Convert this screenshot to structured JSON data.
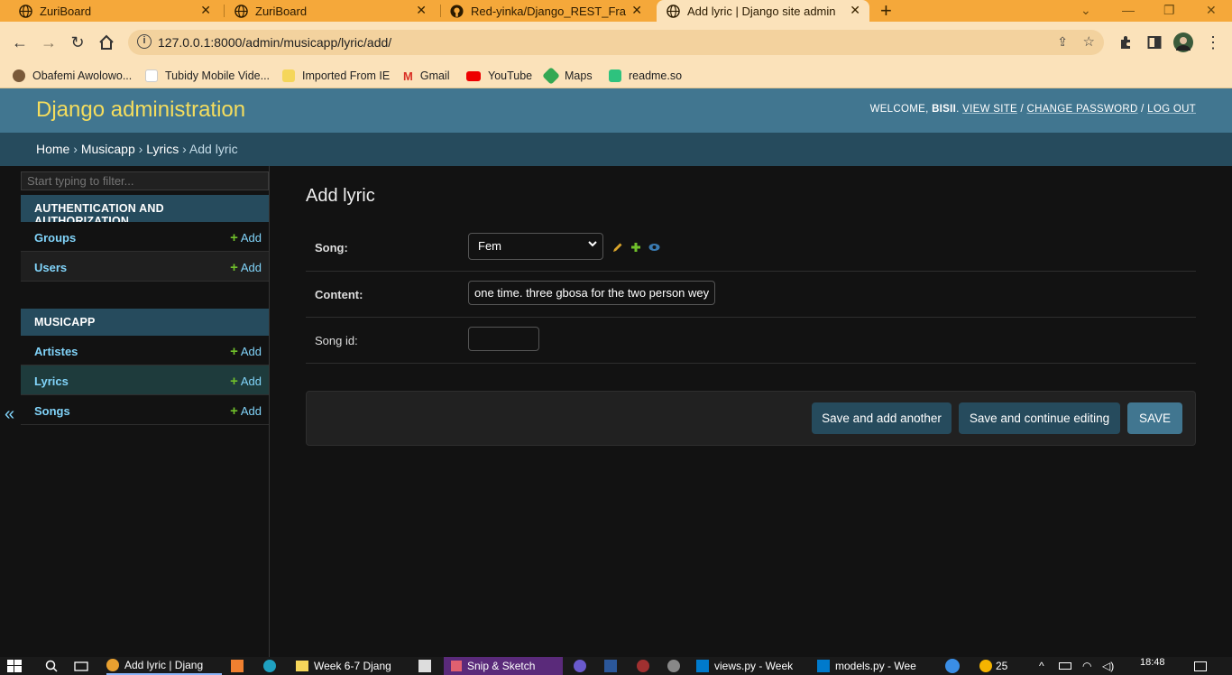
{
  "browser": {
    "tabs": [
      {
        "title": "ZuriBoard",
        "active": false
      },
      {
        "title": "ZuriBoard",
        "active": false
      },
      {
        "title": "Red-yinka/Django_REST_Framew",
        "active": false
      },
      {
        "title": "Add lyric | Django site admin",
        "active": true
      }
    ],
    "new_tab": "+",
    "window_controls": {
      "menu": "⌄",
      "minimize": "—",
      "restore": "❐",
      "close": "✕"
    },
    "url": "127.0.0.1:8000/admin/musicapp/lyric/add/",
    "bookmarks": [
      {
        "label": "Obafemi Awolowo..."
      },
      {
        "label": "Tubidy Mobile Vide..."
      },
      {
        "label": "Imported From IE"
      },
      {
        "label": "Gmail"
      },
      {
        "label": "YouTube"
      },
      {
        "label": "Maps"
      },
      {
        "label": "readme.so"
      }
    ]
  },
  "header": {
    "branding": "Django administration",
    "welcome": "WELCOME,",
    "username": "BISII",
    "view_site": "VIEW SITE",
    "change_password": "CHANGE PASSWORD",
    "logout": "LOG OUT",
    "sep": "/"
  },
  "breadcrumbs": {
    "home": "Home",
    "app": "Musicapp",
    "model": "Lyrics",
    "current": "Add lyric",
    "sep": "›"
  },
  "sidebar": {
    "filter_placeholder": "Start typing to filter...",
    "apps": [
      {
        "caption": "AUTHENTICATION AND AUTHORIZATION",
        "models": [
          {
            "name": "Groups",
            "add": "Add"
          },
          {
            "name": "Users",
            "add": "Add"
          }
        ]
      },
      {
        "caption": "MUSICAPP",
        "models": [
          {
            "name": "Artistes",
            "add": "Add"
          },
          {
            "name": "Lyrics",
            "add": "Add",
            "selected": true
          },
          {
            "name": "Songs",
            "add": "Add"
          }
        ]
      }
    ],
    "collapse": "«"
  },
  "form": {
    "title": "Add lyric",
    "song_label": "Song:",
    "song_value": "Fem",
    "content_label": "Content:",
    "content_value": "one time. three gbosa for the two person wey",
    "song_id_label": "Song id:",
    "song_id_value": ""
  },
  "buttons": {
    "save_add_another": "Save and add another",
    "save_continue": "Save and continue editing",
    "save": "SAVE"
  },
  "taskbar": {
    "items": [
      {
        "label": "Add lyric | Djang"
      },
      {
        "label": "Week 6-7 Djang"
      },
      {
        "label": "Snip & Sketch"
      },
      {
        "label": "views.py - Week"
      },
      {
        "label": "models.py - Wee"
      }
    ],
    "temp": "25",
    "time": "18:48"
  },
  "colors": {
    "header": "#417690",
    "breadcrumbs": "#264b5d",
    "branding": "#f5dd5d",
    "link": "#81d4fa",
    "add_plus": "#70bf2b"
  }
}
